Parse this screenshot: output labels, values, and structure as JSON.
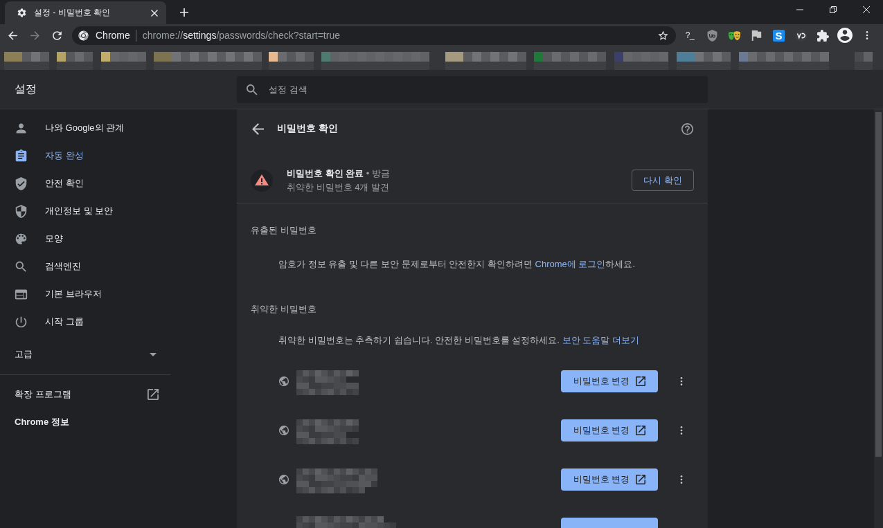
{
  "tab": {
    "title": "설정 - 비밀번호 확인",
    "selected": true
  },
  "nav": [
    {
      "kind": "back",
      "disabled": false
    },
    {
      "kind": "forward",
      "disabled": true
    },
    {
      "kind": "reload",
      "disabled": false
    }
  ],
  "omnibox": {
    "chip": "Chrome",
    "url_scheme": "chrome://",
    "url_host": "settings",
    "url_path": "/passwords/check?start=true",
    "bookmarked": false
  },
  "extensions": [
    {
      "kind": "terminal",
      "label": "?_"
    },
    {
      "kind": "shield"
    },
    {
      "kind": "masks"
    },
    {
      "kind": "flag"
    },
    {
      "kind": "tile",
      "label": "S"
    },
    {
      "kind": "circle-logo"
    },
    {
      "kind": "puzzle"
    }
  ],
  "settings_header": {
    "title": "설정",
    "search": {
      "placeholder": "설정 검색"
    }
  },
  "sidebar": {
    "items": [
      {
        "label": "나와 Google의 관계",
        "selected": false
      },
      {
        "label": "자동 완성",
        "selected": true
      },
      {
        "label": "안전 확인",
        "selected": false
      },
      {
        "label": "개인정보 및 보안",
        "selected": false
      },
      {
        "label": "모양",
        "selected": false
      },
      {
        "label": "검색엔진",
        "selected": false
      },
      {
        "label": "기본 브라우저",
        "selected": false
      },
      {
        "label": "시작 그룹",
        "selected": false
      }
    ],
    "advanced": {
      "label": "고급",
      "expanded": false
    },
    "extensions_link": {
      "label": "확장 프로그램"
    },
    "about": {
      "label": "Chrome 정보"
    }
  },
  "page": {
    "title": "비밀번호 확인"
  },
  "status": {
    "title": "비밀번호 확인 완료",
    "meta": "• 방금",
    "summary": "취약한 비밀번호 4개 발견",
    "button": "다시 확인"
  },
  "sections": [
    {
      "title": "유출된 비밀번호",
      "text_before": "암호가 정보 유출 및 다른 보안 문제로부터 안전한지 확인하려면 ",
      "link": "Chrome에 로그인",
      "text_after": "하세요."
    },
    {
      "title": "취약한 비밀번호",
      "text_before": "취약한 비밀번호는 추측하기 쉽습니다. 안전한 비밀번호를 설정하세요. ",
      "link": "보안 도움말 더보기"
    }
  ],
  "weak_password_rows": [
    {
      "action": "비밀번호 변경",
      "cut_off": false
    },
    {
      "action": "비밀번호 변경",
      "cut_off": false
    },
    {
      "action": "비밀번호 변경",
      "cut_off": false
    },
    {
      "cut_off": true
    }
  ]
}
